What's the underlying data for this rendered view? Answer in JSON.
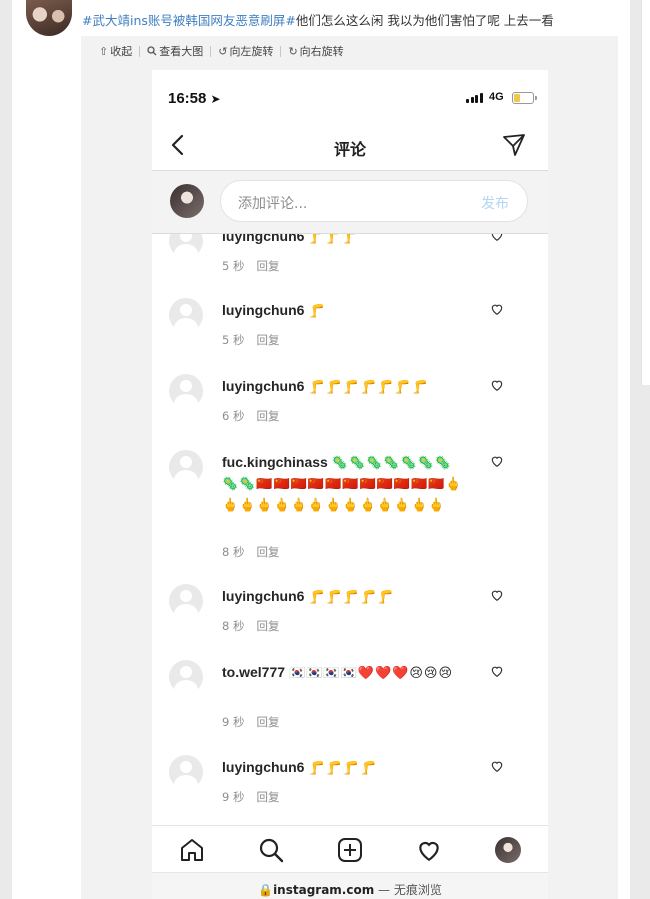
{
  "post": {
    "topic": "#武大靖ins账号被韩国网友恶意刷屏#",
    "text": "他们怎么这么闲 我以为他们害怕了呢 上去一看"
  },
  "image_toolbar": {
    "collapse": "收起",
    "view_large": "查看大图",
    "rotate_left": "向左旋转",
    "rotate_right": "向右旋转"
  },
  "phone": {
    "time": "16:58",
    "network": "4G",
    "nav_title": "评论",
    "compose_placeholder": "添加评论...",
    "post_button": "发布",
    "comments": [
      {
        "user": "luyingchun6",
        "emoji": "🦵🦵🦵",
        "time": "5 秒",
        "reply": "回复"
      },
      {
        "user": "luyingchun6",
        "emoji": "🦵",
        "time": "5 秒",
        "reply": "回复"
      },
      {
        "user": "luyingchun6",
        "emoji": "🦵🦵🦵🦵🦵🦵🦵",
        "time": "6 秒",
        "reply": "回复"
      },
      {
        "user": "fuc.kingchinass",
        "emoji": "🦠🦠🦠🦠🦠🦠🦠🦠🦠🇨🇳🇨🇳🇨🇳🇨🇳🇨🇳🇨🇳🇨🇳🇨🇳🇨🇳🇨🇳🇨🇳🖕🖕🖕🖕🖕🖕🖕🖕🖕🖕🖕🖕🖕🖕",
        "time": "8 秒",
        "reply": "回复"
      },
      {
        "user": "luyingchun6",
        "emoji": "🦵🦵🦵🦵🦵",
        "time": "8 秒",
        "reply": "回复"
      },
      {
        "user": "to.wel777",
        "emoji": "🇰🇷🇰🇷🇰🇷🇰🇷❤️❤️❤️😢😢😢",
        "time": "9 秒",
        "reply": "回复"
      },
      {
        "user": "luyingchun6",
        "emoji": "🦵🦵🦵🦵",
        "time": "9 秒",
        "reply": "回复"
      }
    ],
    "url_domain": "instagram.com",
    "url_suffix": " — 无痕浏览"
  },
  "colors": {
    "topic_link": "#3e7fc1",
    "post_button_disabled": "#b3d6f6",
    "battery": "#f1c84b"
  }
}
